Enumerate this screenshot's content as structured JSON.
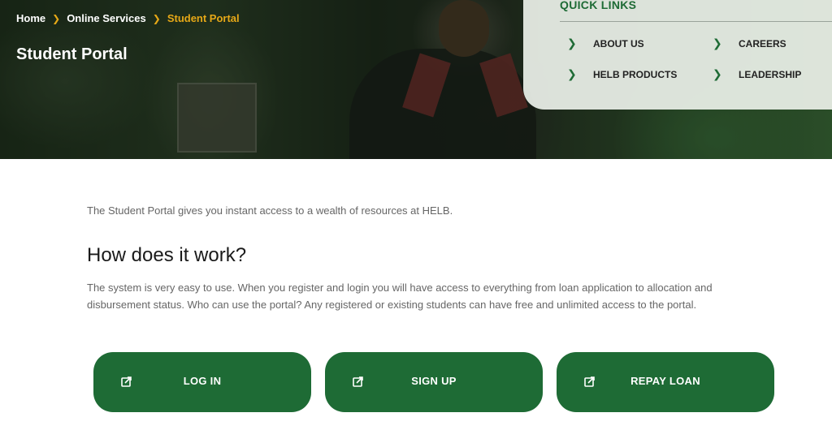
{
  "breadcrumb": {
    "items": [
      "Home",
      "Online Services",
      "Student Portal"
    ]
  },
  "hero": {
    "title": "Student Portal"
  },
  "quick_links": {
    "title": "QUICK LINKS",
    "items": [
      {
        "label": "ABOUT US"
      },
      {
        "label": "CAREERS"
      },
      {
        "label": "HELB PRODUCTS"
      },
      {
        "label": "LEADERSHIP"
      }
    ]
  },
  "content": {
    "intro": "The Student Portal gives you instant access to a wealth of resources at HELB.",
    "heading": "How does it work?",
    "description": "The system is very easy to use. When you register and login you will have access to everything from loan application to allocation and disbursement status. Who can use the portal? Any registered or existing students can have free and unlimited access to the portal."
  },
  "actions": [
    {
      "label": "LOG IN",
      "icon": "external-link-icon"
    },
    {
      "label": "SIGN UP",
      "icon": "external-link-icon"
    },
    {
      "label": "REPAY LOAN",
      "icon": "external-link-icon"
    }
  ],
  "colors": {
    "brand_green": "#1e6b35",
    "breadcrumb_accent": "#e6a817"
  }
}
